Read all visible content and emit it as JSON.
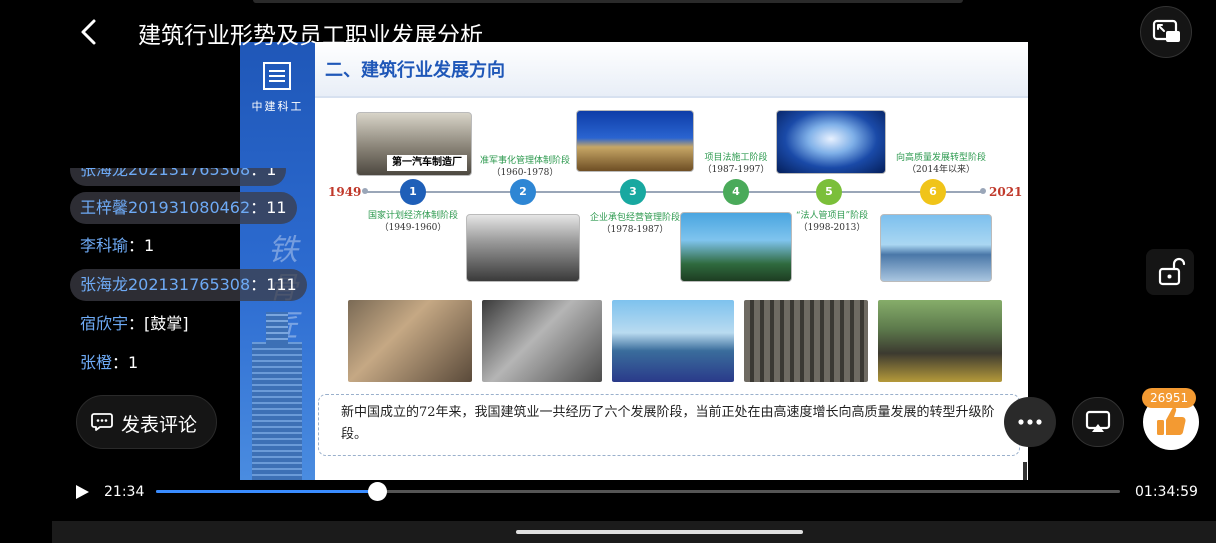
{
  "header": {
    "title": "建筑行业形势及员工职业发展分析"
  },
  "slide": {
    "logo_text": "中建科工",
    "title": "二、建筑行业发展方向",
    "calligraphy": "铁骨匠心",
    "photo_caption": "第一汽车制造厂",
    "start_year": "1949",
    "end_year": "2021",
    "stages": [
      {
        "num": "1",
        "name": "国家计划经济体制阶段",
        "years": "（1949-1960）",
        "color": "#1f5fb8"
      },
      {
        "num": "2",
        "name": "准军事化管理体制阶段",
        "years": "（1960-1978）",
        "color": "#2e86d4"
      },
      {
        "num": "3",
        "name": "企业承包经营管理阶段",
        "years": "（1978-1987）",
        "color": "#18a8a0"
      },
      {
        "num": "4",
        "name": "项目法施工阶段",
        "years": "（1987-1997）",
        "color": "#4aaa5a"
      },
      {
        "num": "5",
        "name": "“法人管项目”阶段",
        "years": "（1998-2013）",
        "color": "#7bbf3a"
      },
      {
        "num": "6",
        "name": "向高质量发展转型阶段",
        "years": "（2014年以来）",
        "color": "#f0c419"
      }
    ],
    "summary": "新中国成立的72年来，我国建筑业一共经历了六个发展阶段，当前正处在由高速度增长向高质量发展的转型升级阶段。"
  },
  "danmaku": [
    {
      "name": "张海龙202131765308",
      "sep": "：",
      "content": "1",
      "pill": true,
      "partial": true
    },
    {
      "name": "王梓馨201931080462",
      "sep": "：",
      "content": "11",
      "pill": true
    },
    {
      "name": "李科瑜",
      "sep": "：",
      "content": "1",
      "pill": false
    },
    {
      "name": "张海龙202131765308",
      "sep": "：",
      "content": "111",
      "pill": true
    },
    {
      "name": "宿欣宇",
      "sep": "：",
      "content": "[鼓掌]",
      "pill": false
    },
    {
      "name": "张橙",
      "sep": "：",
      "content": "1",
      "pill": false
    }
  ],
  "comment_button": {
    "label": "发表评论"
  },
  "like": {
    "count": "26951"
  },
  "player": {
    "current_time": "21:34",
    "total_time": "01:34:59",
    "progress": 0.2296
  },
  "colors": {
    "accent": "#3a8cff",
    "danmaku_name": "#6eaaf5",
    "like_badge": "#f39a32",
    "slide_blue": "#1f57b8"
  },
  "icons": {
    "back": "chevron-left-icon",
    "pip": "picture-in-picture-icon",
    "lock": "unlock-icon",
    "more": "more-horizontal-icon",
    "cast": "cast-icon",
    "like": "thumbs-up-icon",
    "play": "play-icon",
    "comment": "comment-icon"
  }
}
